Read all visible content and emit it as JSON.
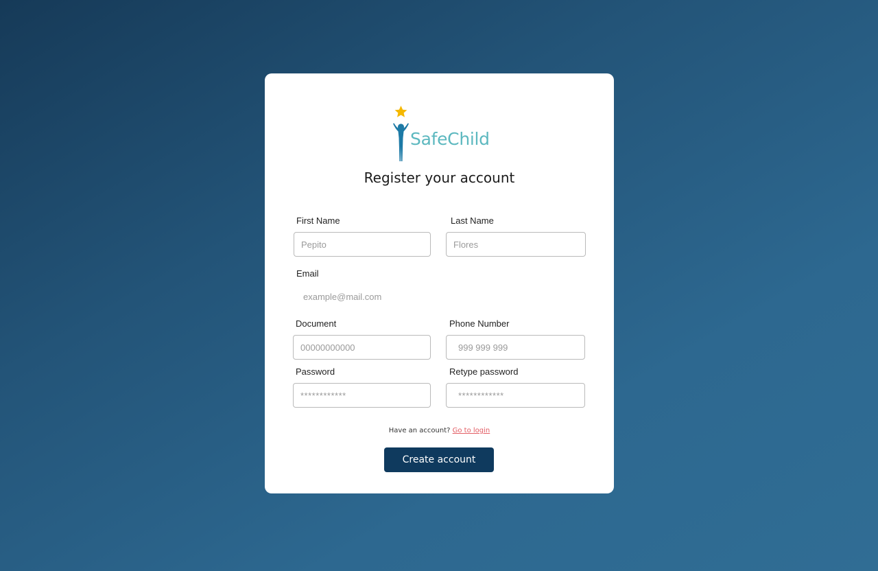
{
  "brand": {
    "name": "SafeChild",
    "star_color": "#f5b800",
    "figure_color": "#1d7aa6",
    "text_color": "#5cb8bf",
    "icons": [
      "star-icon",
      "child-figure-icon"
    ]
  },
  "form": {
    "title": "Register your account",
    "fields": {
      "first_name": {
        "label": "First Name",
        "placeholder": "Pepito"
      },
      "last_name": {
        "label": "Last Name",
        "placeholder": "Flores"
      },
      "email": {
        "label": "Email",
        "placeholder": "example@mail.com"
      },
      "document": {
        "label": "Document",
        "placeholder": "00000000000"
      },
      "phone": {
        "label": "Phone Number",
        "placeholder": "999 999 999"
      },
      "password": {
        "label": "Password",
        "placeholder": "************"
      },
      "retype_password": {
        "label": "Retype password",
        "placeholder": "************"
      }
    },
    "login_prompt": "Have an account?",
    "login_link": "Go to login",
    "submit_label": "Create account"
  },
  "colors": {
    "background_dark": "#163a58",
    "background_light": "#306d94",
    "button": "#0f3a5e",
    "link": "#e25b62"
  }
}
